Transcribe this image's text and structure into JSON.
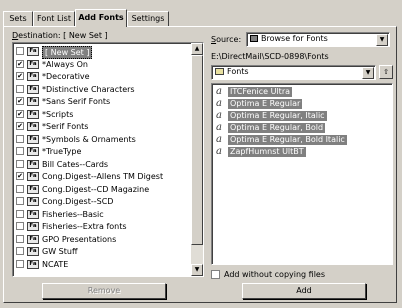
{
  "tabs": [
    "Sets",
    "Font List",
    "Add Fonts",
    "Settings"
  ],
  "destination": {
    "label_prefix": "D",
    "label_rest": "estination: ",
    "selected_text": "[ New Set ]",
    "items": [
      {
        "label": "[ New Set ]",
        "checked": false,
        "selected": true
      },
      {
        "label": "*Always On",
        "checked": true
      },
      {
        "label": "*Decorative",
        "checked": true
      },
      {
        "label": "*Distinctive Characters",
        "checked": false
      },
      {
        "label": "*Sans Serif Fonts",
        "checked": true
      },
      {
        "label": "*Scripts",
        "checked": true
      },
      {
        "label": "*Serif Fonts",
        "checked": true
      },
      {
        "label": "*Symbols & Ornaments",
        "checked": false
      },
      {
        "label": "*TrueType",
        "checked": false
      },
      {
        "label": "Bill Cates--Cards",
        "checked": false
      },
      {
        "label": "Cong.Digest--Allens TM Digest",
        "checked": true
      },
      {
        "label": "Cong.Digest--CD Magazine",
        "checked": false
      },
      {
        "label": "Cong.Digest--SCD",
        "checked": false
      },
      {
        "label": "Fisheries--Basic",
        "checked": false
      },
      {
        "label": "Fisheries--Extra fonts",
        "checked": false
      },
      {
        "label": "GPO Presentations",
        "checked": false
      },
      {
        "label": "GW Stuff",
        "checked": false
      },
      {
        "label": "NCATE",
        "checked": false
      }
    ]
  },
  "source": {
    "label_prefix": "S",
    "label_rest": "ource:",
    "value": "Browse for Fonts",
    "path": "E:\\DirectMail\\SCD-0898\\Fonts",
    "folder": "Fonts"
  },
  "fonts": [
    "ITCFenice Ultra",
    "Optima E Regular",
    "Optima E Regular, Italic",
    "Optima E Regular, Bold",
    "Optima E Regular, Bold Italic",
    "ZapfHumnst UltBT"
  ],
  "add_without_copying": {
    "label": "Add without copying files",
    "checked": false
  },
  "buttons": {
    "remove": "Remove",
    "add": "Add"
  },
  "icons": {
    "checkmark": "✔",
    "font_glyph": "a",
    "row_icon": "Fa"
  }
}
